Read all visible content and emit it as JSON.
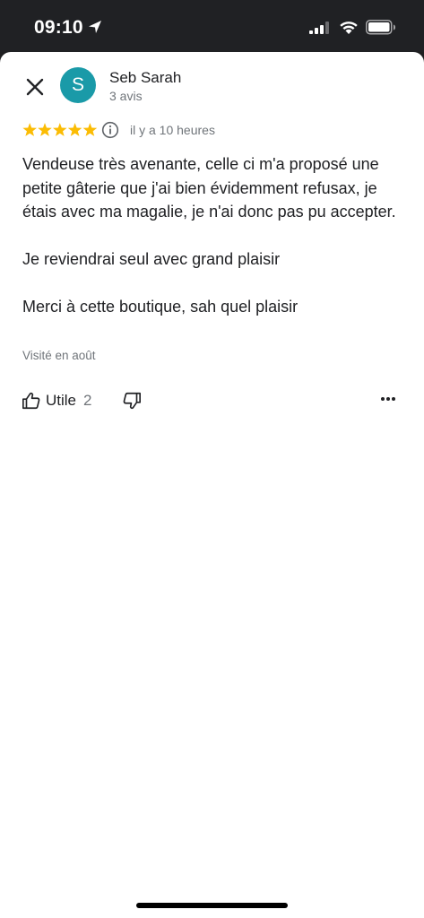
{
  "status_bar": {
    "time": "09:10",
    "icons": [
      "location-arrow-icon",
      "signal-icon",
      "wifi-icon",
      "battery-icon"
    ]
  },
  "header": {
    "close_icon": "close-icon",
    "avatar_letter": "S",
    "avatar_color": "#1a9aa8",
    "author_name": "Seb Sarah",
    "review_count": "3 avis"
  },
  "review": {
    "rating": 5,
    "rating_max": 5,
    "star_color": "#fbbc04",
    "time_ago": "il y a 10 heures",
    "paragraphs": [
      "Vendeuse très avenante, celle ci m'a proposé une petite gâterie que j'ai bien évidemment refusax, je étais avec ma magalie, je n'ai donc pas pu accepter.",
      "Je reviendrai seul avec grand plaisir",
      "Merci à cette boutique, sah quel plaisir"
    ],
    "visited": "Visité en août"
  },
  "actions": {
    "helpful_label": "Utile",
    "helpful_count": "2",
    "icons": [
      "thumbs-up-icon",
      "thumbs-down-icon",
      "more-options-icon"
    ]
  }
}
